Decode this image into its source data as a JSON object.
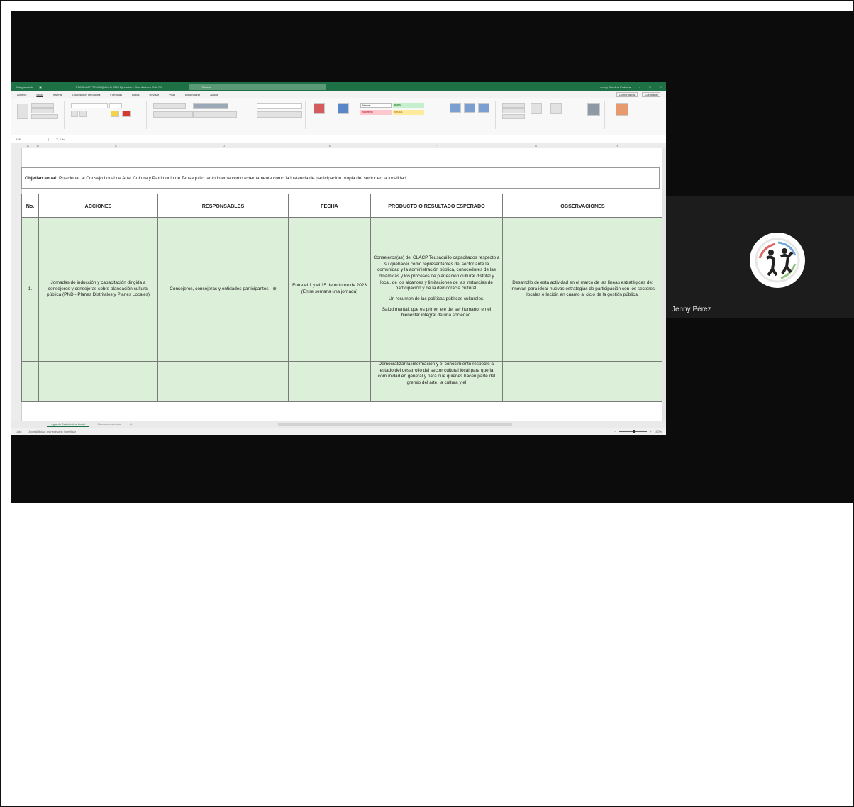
{
  "excel": {
    "title_left": "Autoguardado",
    "title_center": "PPA CLACP TEUSAQUILLO 2023 Ejecución - Guardado en Este PC",
    "search_placeholder": "Buscar",
    "user_name": "Jenny Carolina Pedraza",
    "menu": [
      "Archivo",
      "Inicio",
      "Insertar",
      "Disposición de página",
      "Fórmulas",
      "Datos",
      "Revisar",
      "Vista",
      "Automatizar",
      "Ayuda"
    ],
    "share_buttons": [
      "Comentarios",
      "Compartir"
    ],
    "name_box": "A36",
    "column_letters": [
      "A",
      "B",
      "C",
      "D",
      "E",
      "F",
      "G",
      "H"
    ],
    "styles": {
      "normal": "Normal",
      "buena": "Buena",
      "incorrecto": "Incorrecto",
      "neutral": "Neutral"
    },
    "objective": {
      "label": "Objetivo anual:",
      "text": "Posicionar al Consejo Local de Arte, Cultura y Patrimonio de Teusaquillo tanto interna como externamente como la instancia de participación propia del sector en la localidad."
    },
    "headers": {
      "no": "No.",
      "acciones": "ACCIONES",
      "responsables": "RESPONSABLES",
      "fecha": "FECHA",
      "producto": "PRODUCTO O RESULTADO ESPERADO",
      "observaciones": "OBSERVACIONES"
    },
    "row1": {
      "no": "1.",
      "acciones": "Jornadas de inducción y capacitación dirigida a consejeros y consejeras sobre planeación cultural pública (PND - Planes Distritales y Planes Locales)",
      "responsables": "Consejeros, consejeras y entidades participantes",
      "fecha_line1": "Entre el 1 y el 15 de octubre de 2023",
      "fecha_line2": "(Entre semana una jornada)",
      "producto_1": "Consejeros(as) del CLACP Teusaquillo capacitados respecto a su quehacer como representantes del sector ante la comunidad y la administración pública, conocedores de las dinámicas y los procesos de planeación cultural distrital y local, de los alcances y limitaciones de las instancias de participación y de la democracia cultural.",
      "producto_2": "Un resumen de las políticas públicas culturales.",
      "producto_3": "Salud mental, que es primer eje del ser humano, en el bienestar integral de una sociedad.",
      "observaciones": "Desarrollo de esta actividad en el marco de las líneas estratégicas de: Innovar, para idear nuevas estrategias de participación con los sectores locales e Incidir, en cuanto al ciclo de la gestión pública."
    },
    "row2": {
      "producto": "Democratizar la información y el conocimiento respecto al estado del desarrollo del sector cultural local para que la comunidad en general y para que quienes hacen parte del gremio del arte, la cultura y el"
    },
    "sheet_tabs": [
      "Agenda Participativa Anual",
      "Recomendaciones"
    ],
    "status_text": "Listo",
    "accessibility_text": "Accesibilidad: es necesario investigar",
    "zoom": "100%"
  },
  "participant": {
    "name": "Jenny Pérez"
  },
  "colors": {
    "excel_green": "#1e7145",
    "cell_green": "#dcefd8",
    "meeting_bg": "#0c0c0c"
  }
}
